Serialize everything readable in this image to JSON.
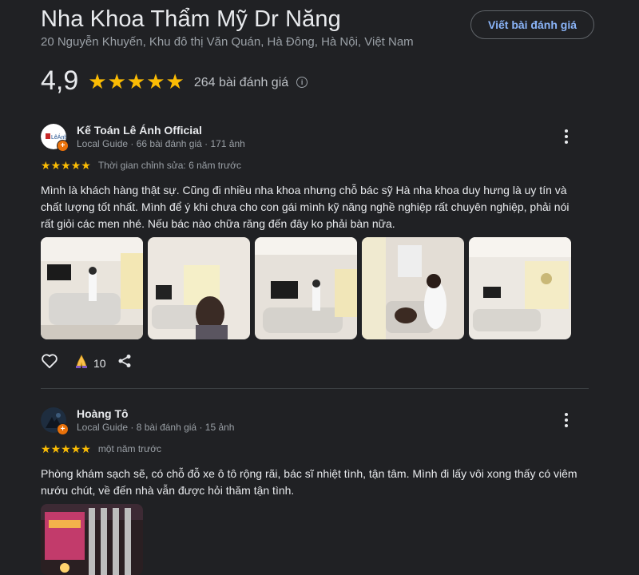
{
  "place": {
    "title": "Nha Khoa Thẩm Mỹ Dr Năng",
    "address": "20 Nguyễn Khuyến, Khu đô thị Văn Quán, Hà Đông, Hà Nội, Việt Nam",
    "write_review_label": "Viết bài đánh giá",
    "rating": "4,9",
    "stars": 5,
    "review_count": "264 bài đánh giá"
  },
  "reviews": [
    {
      "name": "Kế Toán Lê Ánh Official",
      "meta": "Local Guide · 66 bài đánh giá · 171 ảnh",
      "stars": 5,
      "when": "Thời gian chỉnh sửa: 6 năm trước",
      "text": "Mình là khách hàng thật sự. Cũng đi nhiều nha khoa nhưng chỗ bác sỹ Hà nha khoa duy hưng là uy tín và chất lượng tốt nhất. Mình để ý khi chưa cho con gái mình kỹ năng nghề nghiệp rất chuyên nghiệp, phải nói rất giỏi các men nhé. Nếu bác nào chữa răng đến đây ko phải bàn nữa.",
      "photo_count": 5,
      "reaction_count": "10"
    },
    {
      "name": "Hoàng Tô",
      "meta": "Local Guide · 8 bài đánh giá · 15 ảnh",
      "stars": 5,
      "when": "một năm trước",
      "text": "Phòng khám sạch sẽ, có chỗ đỗ xe ô tô rộng rãi, bác sĩ nhiệt tình, tận tâm. Mình đi lấy vôi xong thấy có viêm nướu chút, về đến nhà vẫn được hỏi thăm tận tình.",
      "photo_count": 1
    }
  ],
  "avatar_logo_text": "LêÁnh",
  "colors": {
    "background": "#202124",
    "star": "#fbbc04",
    "link": "#8ab4f8",
    "badge": "#e8710a"
  },
  "icons": [
    "info-icon",
    "more-vert-icon",
    "heart-icon",
    "pray-hands-icon",
    "share-icon",
    "local-guide-badge-icon"
  ]
}
